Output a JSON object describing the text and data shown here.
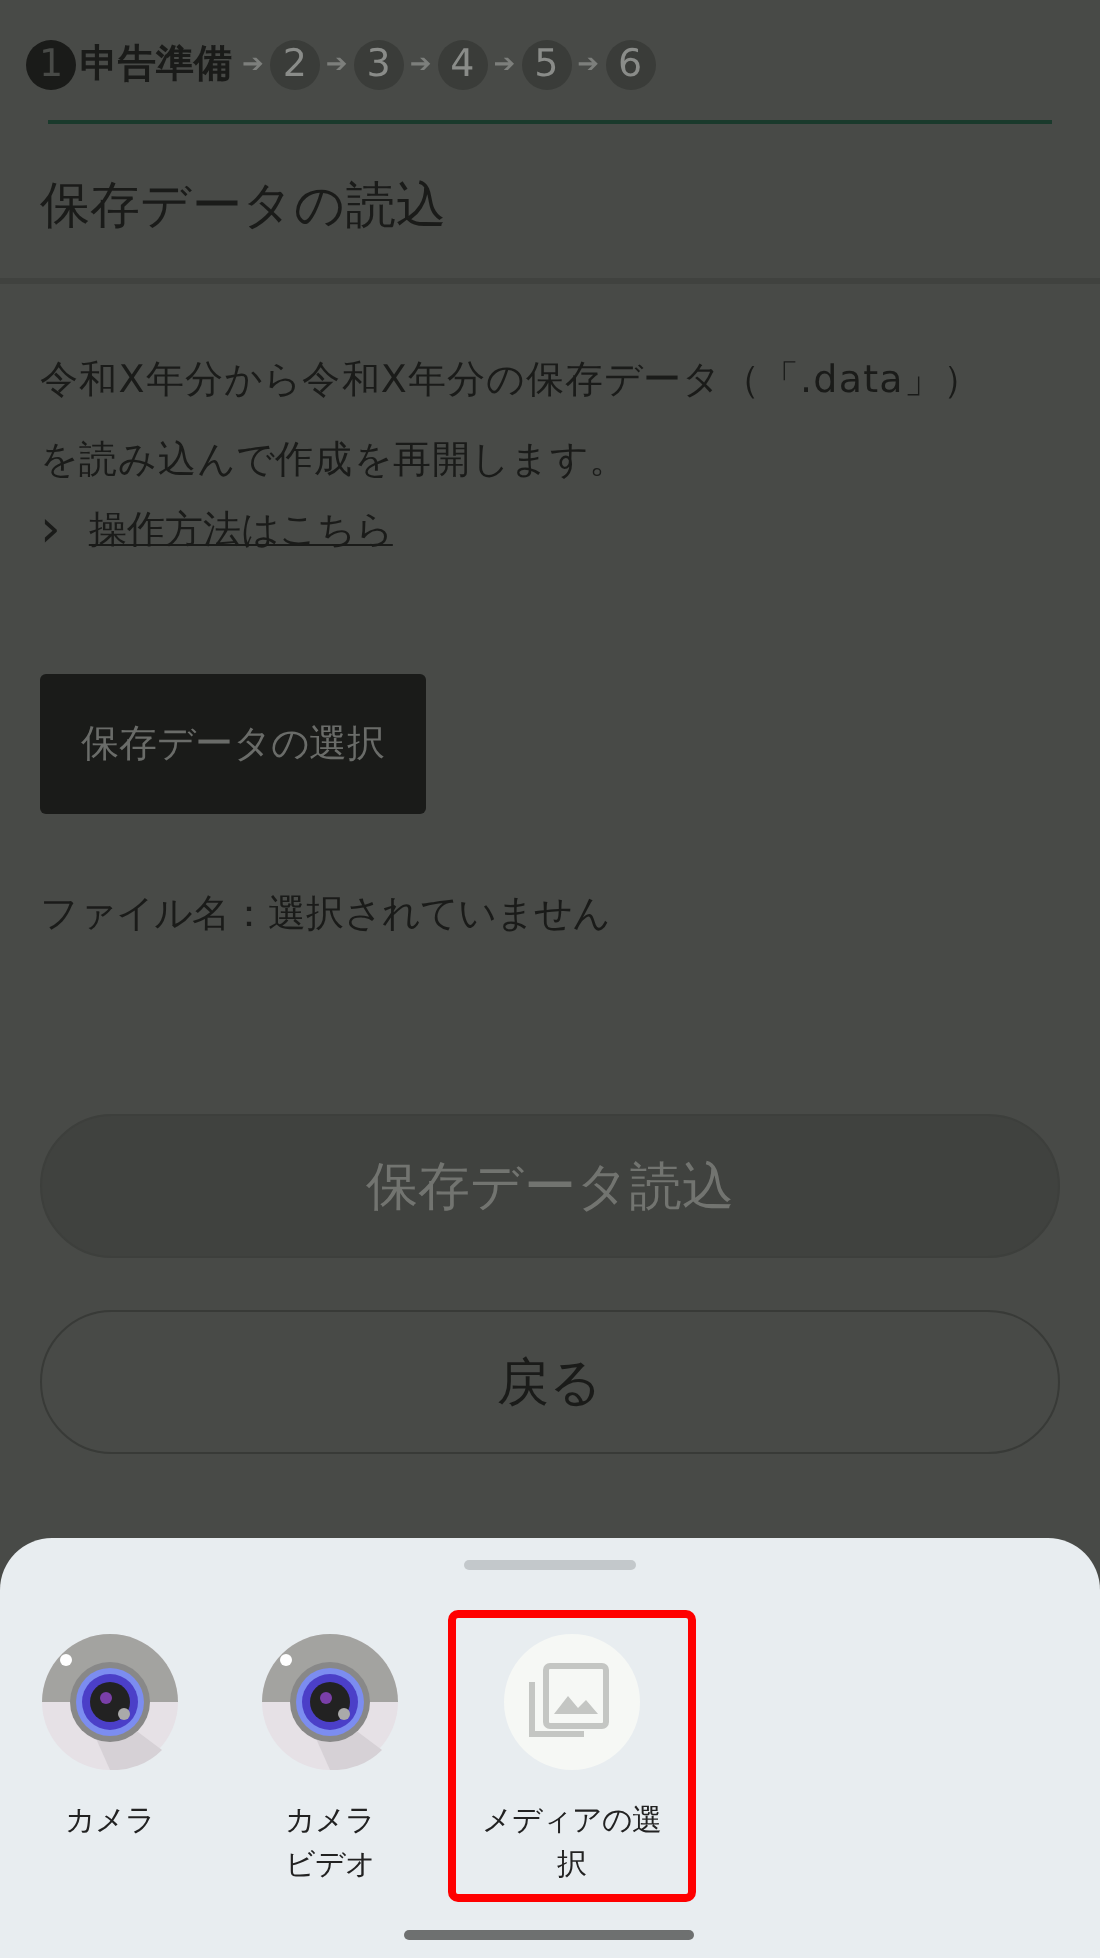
{
  "steps": [
    {
      "number": "1",
      "label": "申告準備",
      "selected": true
    },
    {
      "number": "2",
      "selected": false
    },
    {
      "number": "3",
      "selected": false
    },
    {
      "number": "4",
      "selected": false
    },
    {
      "number": "5",
      "selected": false
    },
    {
      "number": "6",
      "selected": false
    }
  ],
  "step_arrow": "➔",
  "title": "保存データの読込",
  "description": "令和X年分から令和X年分の保存データ（「.data」）を読み込んで作成を再開します。",
  "help_link": {
    "chevron": "›",
    "text": "操作方法はこちら"
  },
  "select_button": "保存データの選択",
  "file_name": "ファイル名：選択されていません",
  "load_button": {
    "label": "保存データ読込",
    "disabled": true
  },
  "back_button": "戻る",
  "sheet": {
    "options": [
      {
        "kind": "camera",
        "label": "カメラ",
        "selected": false
      },
      {
        "kind": "camera",
        "label": "カメラ",
        "label_2": "ビデオ",
        "selected": false
      },
      {
        "kind": "media",
        "label": "メディアの選択",
        "selected": true
      }
    ]
  }
}
